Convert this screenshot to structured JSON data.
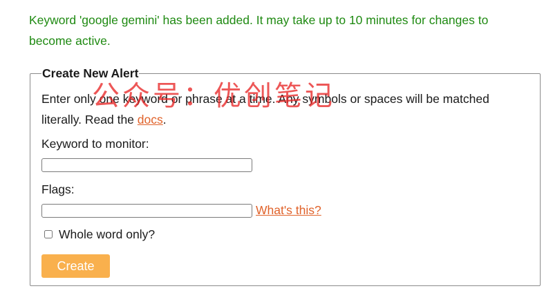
{
  "notice": {
    "text": "Keyword 'google gemini' has been added. It may take up to 10 minutes for changes to become active."
  },
  "form": {
    "legend": "Create New Alert",
    "intro_before_link": "Enter only one keyword or phrase at a time. Any symbols or spaces will be matched literally. Read the ",
    "docs_link": "docs",
    "intro_after_link": ".",
    "keyword_label": "Keyword to monitor:",
    "keyword_value": "",
    "flags_label": "Flags:",
    "flags_value": "",
    "whats_this_link": "What's this?",
    "whole_word_label": "Whole word only?",
    "whole_word_checked": false,
    "create_button": "Create"
  },
  "watermark": {
    "text": "公众号：优创笔记"
  },
  "colors": {
    "notice": "#1f8a12",
    "link": "#e0622a",
    "button_bg": "#f9b04d",
    "watermark": "#e82828"
  }
}
